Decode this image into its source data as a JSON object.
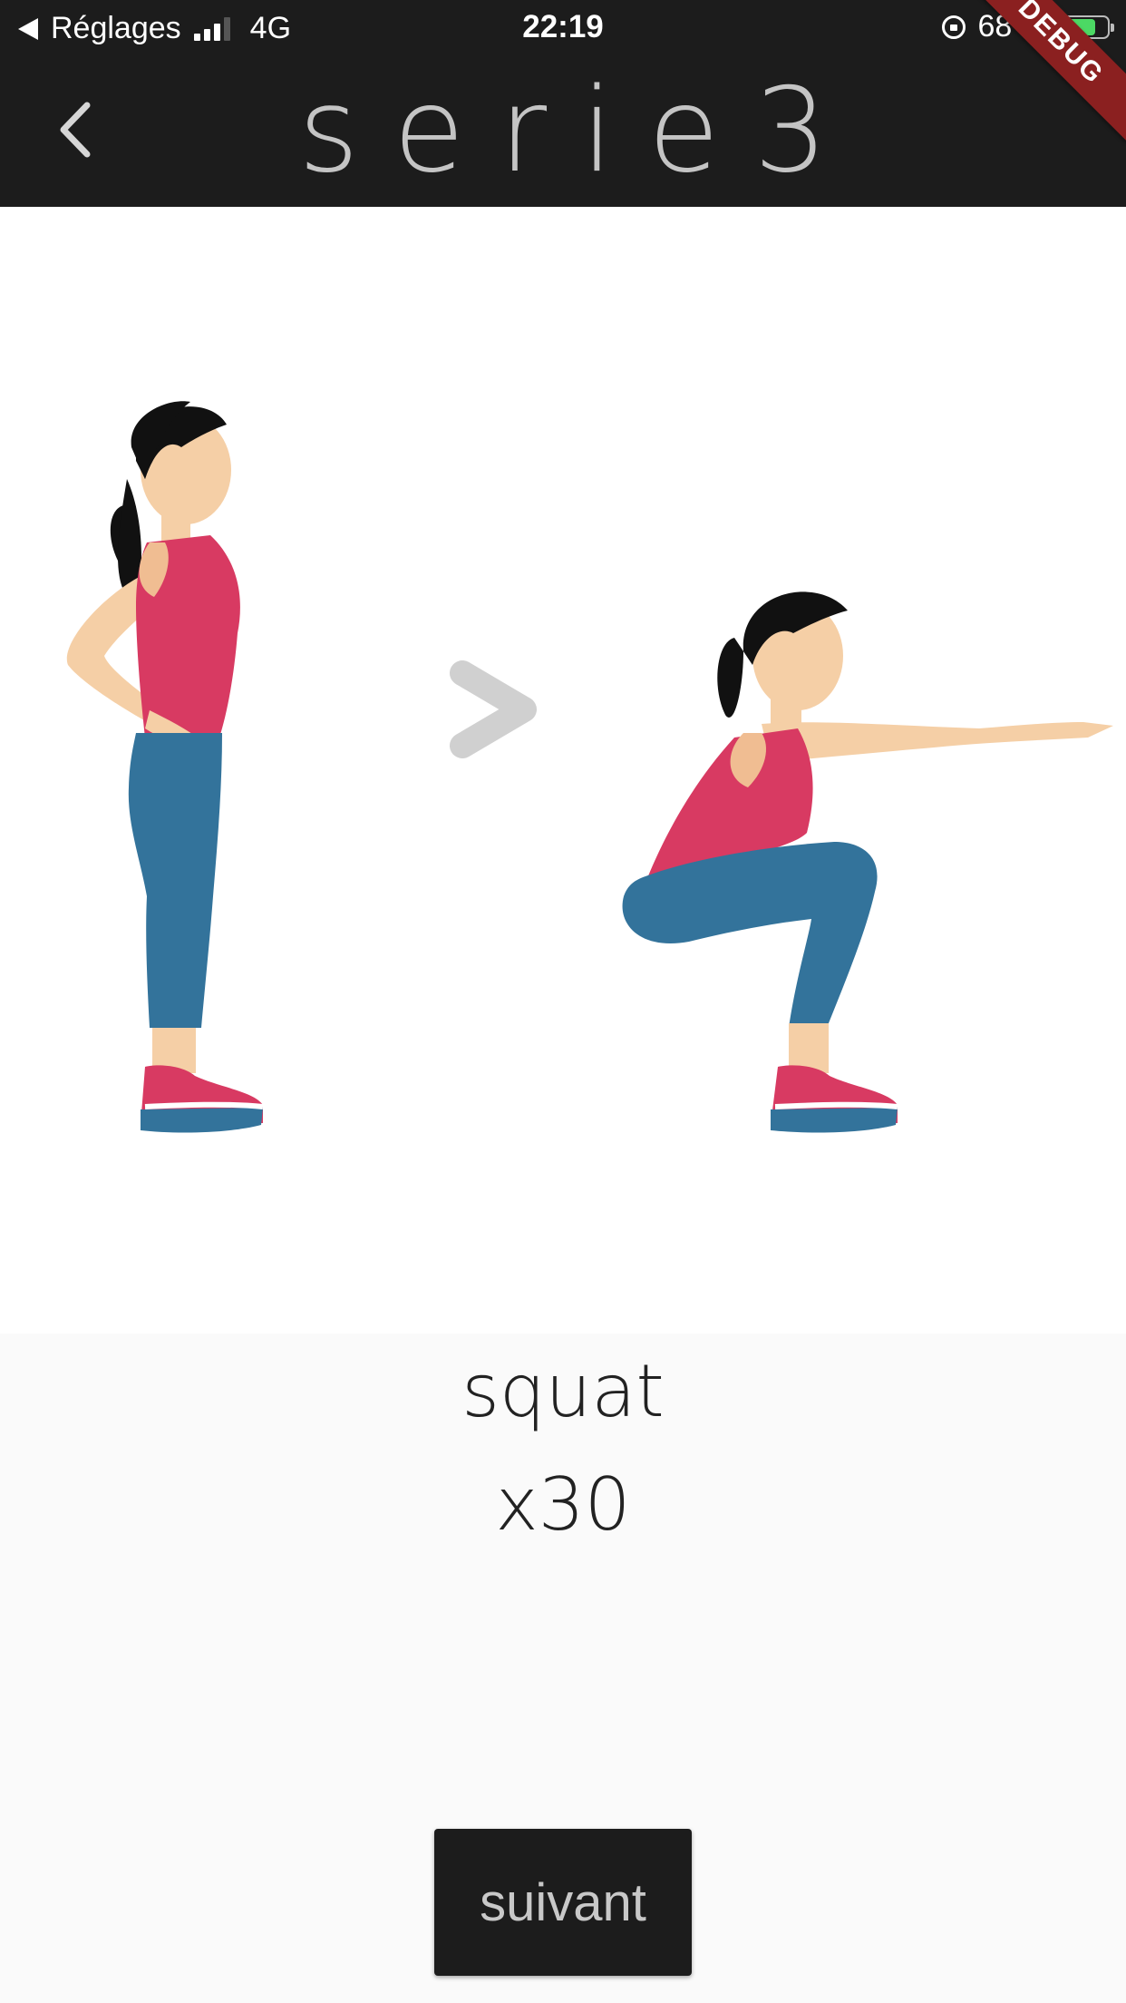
{
  "status_bar": {
    "back_app": "Réglages",
    "carrier": "4G",
    "time": "22:19",
    "battery": "68 %"
  },
  "header": {
    "title": "serie3",
    "debug_banner": "DEBUG"
  },
  "exercise": {
    "name": "squat",
    "reps": "x30",
    "illustration": "standing-to-squat"
  },
  "actions": {
    "next_label": "suivant"
  },
  "colors": {
    "app_bar": "#1c1c1c",
    "title": "#c4c4c4",
    "tank_top": "#d83a62",
    "leggings": "#33739b",
    "skin": "#f5cfa6",
    "arrow": "#d0d0d0"
  }
}
